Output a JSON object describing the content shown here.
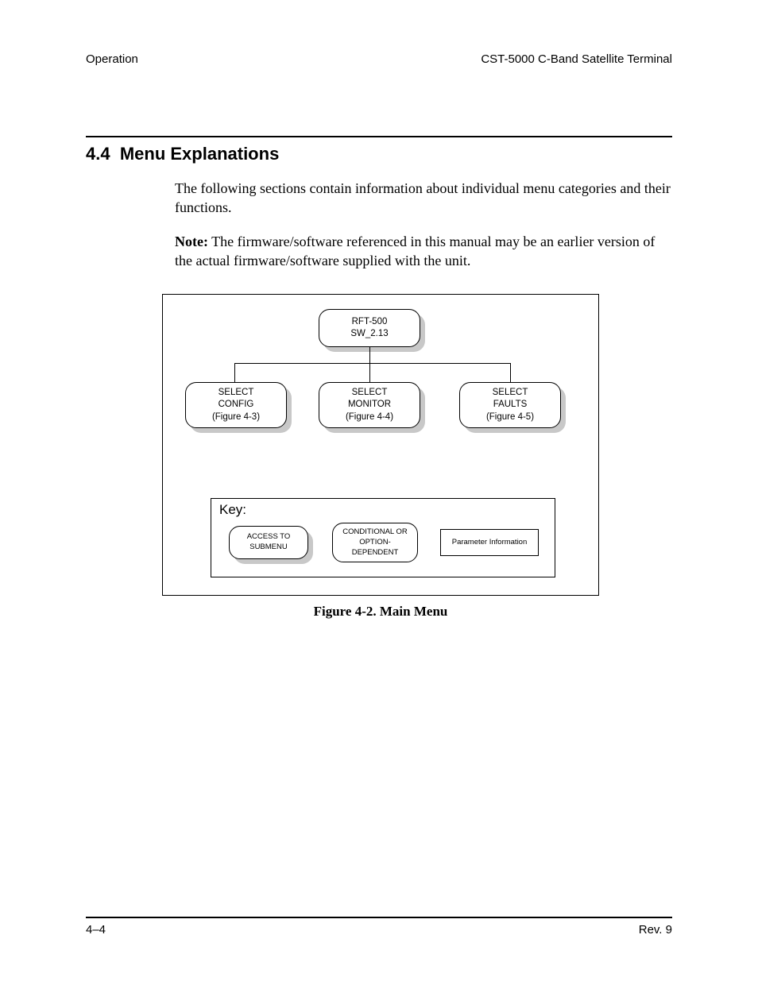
{
  "header": {
    "left": "Operation",
    "right": "CST-5000 C-Band Satellite Terminal"
  },
  "section": {
    "number": "4.4",
    "title": "Menu Explanations"
  },
  "paragraphs": {
    "intro": "The following sections contain information about individual menu categories and their functions.",
    "note_label": "Note:",
    "note_body": " The firmware/software referenced in this manual may be an earlier version of the actual firmware/software supplied with the unit."
  },
  "diagram": {
    "root": {
      "line1": "RFT-500",
      "line2": "SW_2.13"
    },
    "children": [
      {
        "line1": "SELECT",
        "line2": "CONFIG",
        "line3": "(Figure 4-3)"
      },
      {
        "line1": "SELECT",
        "line2": "MONITOR",
        "line3": "(Figure 4-4)"
      },
      {
        "line1": "SELECT",
        "line2": "FAULTS",
        "line3": "(Figure 4-5)"
      }
    ],
    "key": {
      "title": "Key:",
      "submenu": {
        "line1": "ACCESS TO",
        "line2": "SUBMENU"
      },
      "conditional": {
        "line1": "CONDITIONAL OR",
        "line2": "OPTION-",
        "line3": "DEPENDENT"
      },
      "param": "Parameter Information"
    },
    "caption": "Figure 4-2.  Main Menu"
  },
  "footer": {
    "left": "4–4",
    "right": "Rev. 9"
  }
}
